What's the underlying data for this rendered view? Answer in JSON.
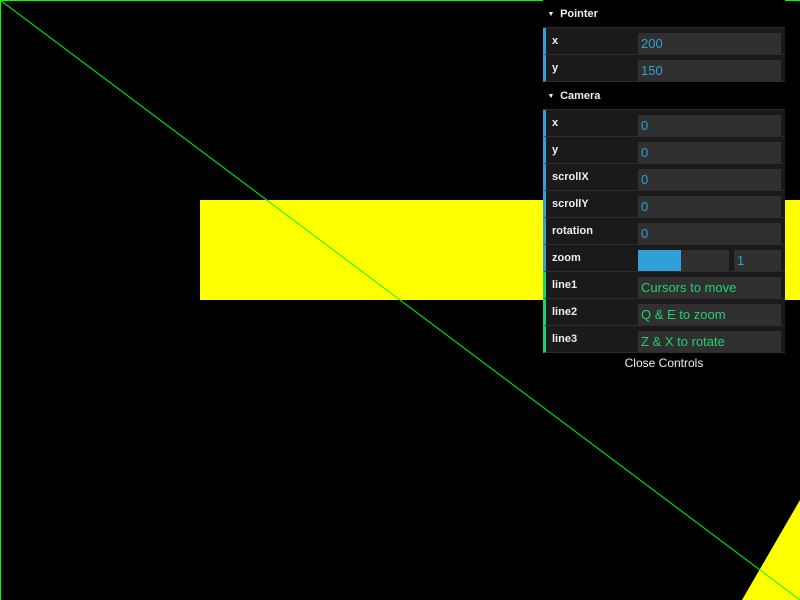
{
  "scene": {
    "background": "#000000",
    "line_color": "#00ff00",
    "shape_color": "#ffff00"
  },
  "gui": {
    "pointer": {
      "title": "Pointer",
      "x_label": "x",
      "x_value": "200",
      "y_label": "y",
      "y_value": "150"
    },
    "camera": {
      "title": "Camera",
      "x_label": "x",
      "x_value": "0",
      "y_label": "y",
      "y_value": "0",
      "scrollX_label": "scrollX",
      "scrollX_value": "0",
      "scrollY_label": "scrollY",
      "scrollY_value": "0",
      "rotation_label": "rotation",
      "rotation_value": "0",
      "zoom_label": "zoom",
      "zoom_value": "1",
      "zoom_fill_fraction": 0.47,
      "line1_label": "line1",
      "line1_value": "Cursors to move",
      "line2_label": "line2",
      "line2_value": "Q & E to zoom",
      "line3_label": "line3",
      "line3_value": "Z & X to rotate"
    },
    "close_label": "Close Controls",
    "number_color": "#2fa1d6",
    "string_color": "#1ed36f"
  }
}
